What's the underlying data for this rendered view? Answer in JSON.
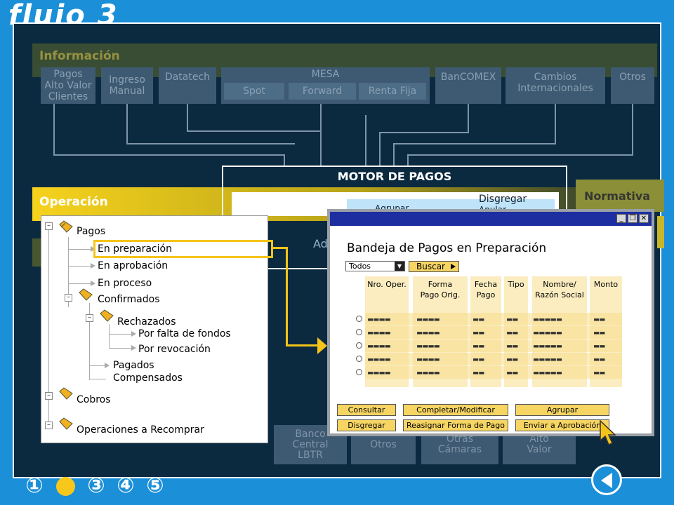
{
  "header": {
    "title": "flujo 3"
  },
  "info": {
    "label": "Información",
    "sources": [
      "Pagos\nAlto Valor\nClientes",
      "Ingreso\nManual",
      "Datatech",
      "BanCOMEX",
      "Cambios\nInternacionales",
      "Otros"
    ],
    "mesa": {
      "label": "MESA",
      "subs": [
        "Spot",
        "Forward",
        "Renta Fija"
      ]
    }
  },
  "motor": {
    "title": "MOTOR DE PAGOS",
    "pill_top": "Disgregar",
    "pill_mid": "Agrupar",
    "pill_bot": "Anular"
  },
  "operacion": {
    "label": "Operación",
    "normativa": "Normativa",
    "ad": "Ad"
  },
  "bottom": [
    "Banco\nCentral\nLBTR",
    "Otros",
    "Otras\nCámaras",
    "Alto\nValor"
  ],
  "tree": {
    "pagos": "Pagos",
    "en_preparacion": "En preparación",
    "en_aprobacion": "En aprobación",
    "en_proceso": "En proceso",
    "confirmados": "Confirmados",
    "rechazados": "Rechazados",
    "por_falta": "Por falta de fondos",
    "por_revocacion": "Por revocación",
    "pagados": "Pagados",
    "compensados": "Compensados",
    "cobros": "Cobros",
    "recomprar": "Operaciones a Recomprar"
  },
  "window": {
    "title": "Bandeja de Pagos en Preparación",
    "filter_value": "Todos",
    "search_label": "Buscar",
    "columns": [
      "Nro. Oper.",
      "Forma\nPago Orig.",
      "Fecha\nPago",
      "Tipo",
      "Nombre/\nRazón Social",
      "Monto"
    ],
    "row_placeholder": [
      "▬▬▬▬",
      "▬▬▬▬",
      "▬▬",
      "▬▬",
      "▬▬▬▬▬",
      "▬▬"
    ],
    "actions": {
      "consultar": "Consultar",
      "completar": "Completar/Modificar",
      "agrupar": "Agrupar",
      "disgregar": "Disgregar",
      "reasignar": "Reasignar Forma de Pago",
      "enviar": "Enviar a Aprobación"
    }
  },
  "nav": {
    "steps": [
      "①",
      "②",
      "③",
      "④",
      "⑤"
    ],
    "current": 2
  },
  "colors": {
    "accent": "#f4c41a",
    "board": "#0b2a40",
    "frame": "#1b8fd8",
    "titlebar": "#1c2ea0"
  }
}
